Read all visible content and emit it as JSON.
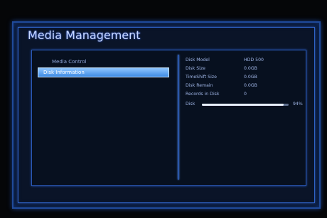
{
  "title": "Media Management",
  "menu": {
    "items": [
      {
        "label": "Media Control",
        "selected": false
      },
      {
        "label": "Disk Information",
        "selected": true
      }
    ]
  },
  "disk_info": {
    "rows": [
      {
        "label": "Disk Model",
        "value": "HDD 500"
      },
      {
        "label": "Disk Size",
        "value": "0.0GB"
      },
      {
        "label": "TimeShift Size",
        "value": "0.0GB"
      },
      {
        "label": "Disk Remain",
        "value": "0.0GB"
      },
      {
        "label": "Records in Disk",
        "value": "0"
      }
    ],
    "disk_label": "Disk",
    "usage_percent": "94%",
    "usage_fraction": 0.94
  },
  "colors": {
    "accent": "#2f63c7",
    "selected": "#6aa9f0",
    "text": "#9fb5e6"
  }
}
